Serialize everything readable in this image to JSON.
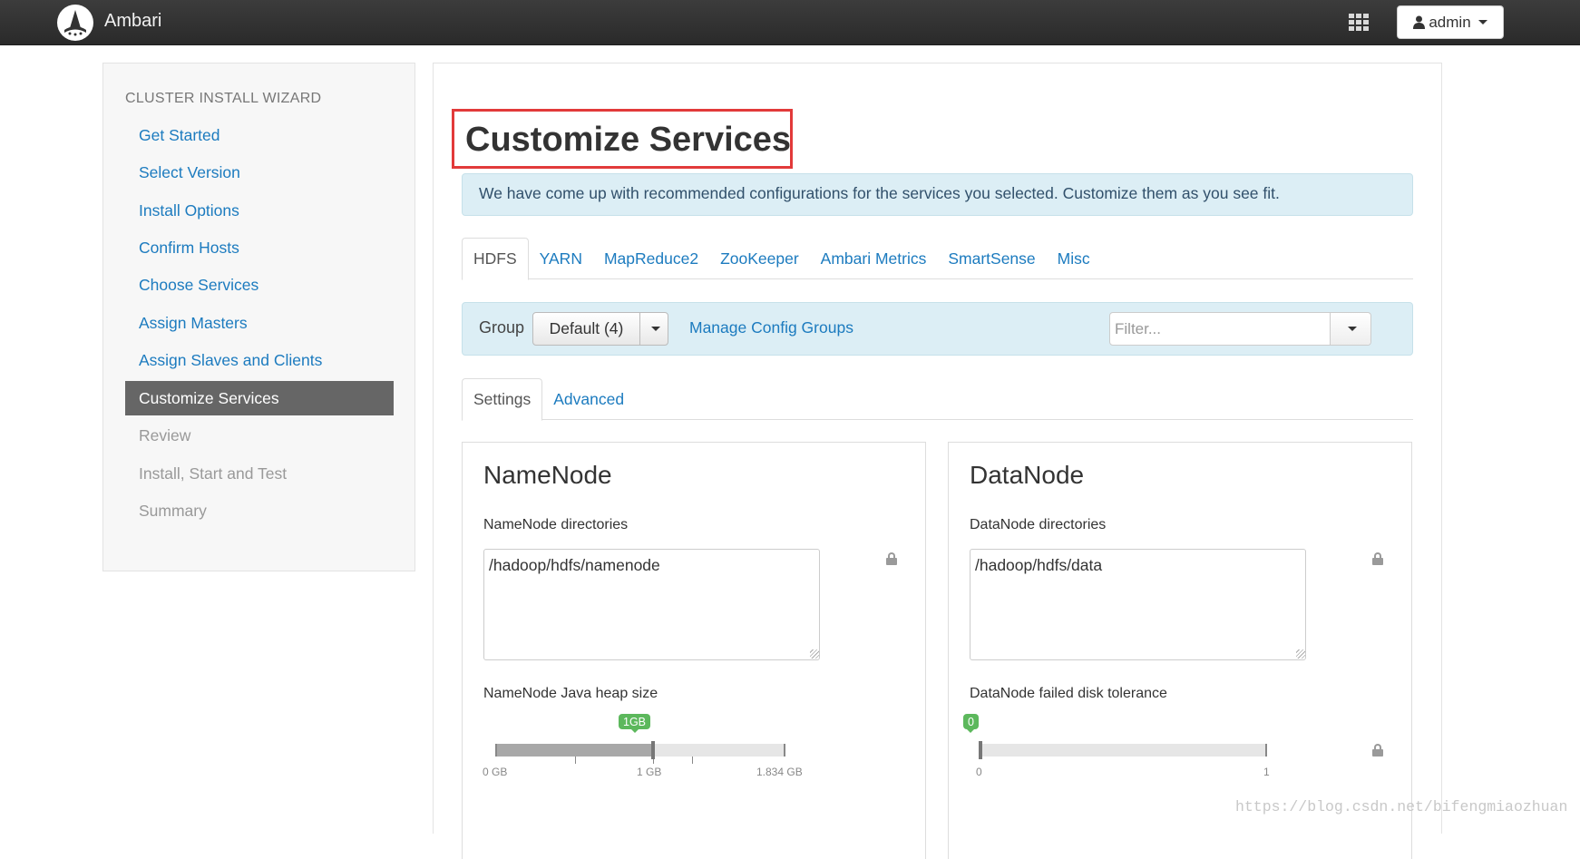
{
  "app": {
    "brand": "Ambari",
    "logo_icon": "ambari-logo-icon"
  },
  "header": {
    "apps_icon": "grid-apps-icon",
    "user_icon": "user-icon",
    "user_label": "admin"
  },
  "sidebar": {
    "title": "CLUSTER INSTALL WIZARD",
    "items": [
      {
        "label": "Get Started",
        "state": "link"
      },
      {
        "label": "Select Version",
        "state": "link"
      },
      {
        "label": "Install Options",
        "state": "link"
      },
      {
        "label": "Confirm Hosts",
        "state": "link"
      },
      {
        "label": "Choose Services",
        "state": "link"
      },
      {
        "label": "Assign Masters",
        "state": "link"
      },
      {
        "label": "Assign Slaves and Clients",
        "state": "link"
      },
      {
        "label": "Customize Services",
        "state": "active"
      },
      {
        "label": "Review",
        "state": "disabled"
      },
      {
        "label": "Install, Start and Test",
        "state": "disabled"
      },
      {
        "label": "Summary",
        "state": "disabled"
      }
    ]
  },
  "main": {
    "title": "Customize Services",
    "alert": "We have come up with recommended configurations for the services you selected. Customize them as you see fit.",
    "service_tabs": [
      "HDFS",
      "YARN",
      "MapReduce2",
      "ZooKeeper",
      "Ambari Metrics",
      "SmartSense",
      "Misc"
    ],
    "active_service_tab": "HDFS",
    "group": {
      "label": "Group",
      "selected": "Default (4)",
      "manage_link": "Manage Config Groups"
    },
    "filter": {
      "placeholder": "Filter...",
      "value": ""
    },
    "sub_tabs": [
      "Settings",
      "Advanced"
    ],
    "active_sub_tab": "Settings",
    "namenode": {
      "title": "NameNode",
      "dirs_label": "NameNode directories",
      "dirs_value": "/hadoop/hdfs/namenode",
      "heap_label": "NameNode Java heap size",
      "heap_badge": "1GB",
      "heap_value_gb": 1,
      "heap_max_gb": 1.834,
      "heap_ticks": [
        "0 GB",
        "1 GB",
        "1.834 GB"
      ]
    },
    "datanode": {
      "title": "DataNode",
      "dirs_label": "DataNode directories",
      "dirs_value": "/hadoop/hdfs/data",
      "tolerance_label": "DataNode failed disk tolerance",
      "tolerance_badge": "0",
      "tolerance_value": 0,
      "tolerance_ticks": [
        "0",
        "1"
      ]
    }
  },
  "watermark": "https://blog.csdn.net/bifengmiaozhuan",
  "colors": {
    "accent": "#1c7bbf",
    "highlight_box": "#e23a3a",
    "alert_bg": "#dceef5",
    "badge_green": "#5cb85c"
  }
}
